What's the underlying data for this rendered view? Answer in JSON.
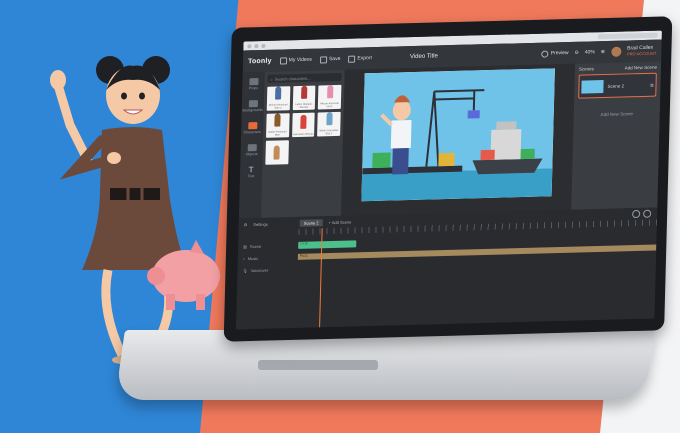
{
  "app": {
    "logo_text": "Toonly",
    "menu_my_videos": "My Videos",
    "menu_save": "Save",
    "menu_export": "Export",
    "video_title": "Video Title",
    "preview_label": "Preview",
    "zoom_level": "40%",
    "user_name": "Brad Callen",
    "user_badge": "PRO ACCOUNT"
  },
  "sidebar": {
    "items": [
      {
        "label": "Props",
        "icon": "props-icon"
      },
      {
        "label": "Backgrounds",
        "icon": "backgrounds-icon"
      },
      {
        "label": "Characters",
        "icon": "characters-icon",
        "active": true
      },
      {
        "label": "Objects",
        "icon": "objects-icon"
      },
      {
        "label": "Text",
        "icon": "text-icon"
      }
    ]
  },
  "library": {
    "search_placeholder": "Search characters...",
    "items": [
      {
        "caption": "African American Man 1",
        "color": "#4a6fa5"
      },
      {
        "caption": "Latino Hispanic Woman",
        "color": "#b33a3a"
      },
      {
        "caption": "African American Girl 1",
        "color": "#e58fb0"
      },
      {
        "caption": "Native American Man",
        "color": "#8b5a2b"
      },
      {
        "caption": "Caucasian Woman",
        "color": "#d7453b"
      },
      {
        "caption": "White Caucasian Boy 1",
        "color": "#6ea3c9"
      },
      {
        "caption": "",
        "color": "#c48b5a"
      }
    ]
  },
  "scenes": {
    "title": "Scenes",
    "add_new_scene_link": "Add New Scene",
    "scene_card_label": "Scene 2",
    "add_new_scene_button": "Add New Scene"
  },
  "timeline": {
    "settings_label": "Settings",
    "scene_tab": "Scene 2",
    "add_scene_tab": "+ Add Scene",
    "rows": [
      {
        "label": "Scene",
        "bar": "Dr.M"
      },
      {
        "label": "Music",
        "bar": "Puzz"
      },
      {
        "label": "Voiceover",
        "bar": ""
      }
    ]
  },
  "colors": {
    "accent": "#f06a4a",
    "bg_blue": "#2f86d6",
    "bg_coral": "#f0795c"
  }
}
